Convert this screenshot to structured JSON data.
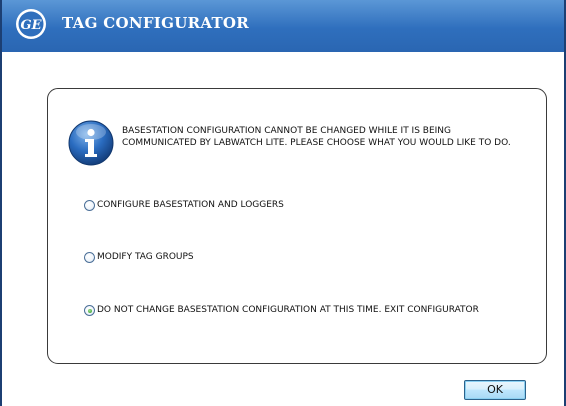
{
  "window": {
    "title": "TAG CONFIGURATOR",
    "logo_text": "GE"
  },
  "dialog": {
    "message": "BASESTATION CONFIGURATION CANNOT BE CHANGED WHILE IT IS BEING COMMUNICATED BY LABWATCH LITE. PLEASE CHOOSE WHAT YOU WOULD LIKE TO DO.",
    "options": [
      {
        "label": "CONFIGURE BASESTATION AND LOGGERS",
        "selected": false
      },
      {
        "label": "MODIFY TAG GROUPS",
        "selected": false
      },
      {
        "label": "DO NOT CHANGE BASESTATION CONFIGURATION AT THIS TIME. EXIT CONFIGURATOR",
        "selected": true
      }
    ]
  },
  "buttons": {
    "ok_label": "OK"
  },
  "colors": {
    "titlebar": "#2f6fbd",
    "window_border": "#1c3f73",
    "info_icon": "#1f5fb0"
  }
}
